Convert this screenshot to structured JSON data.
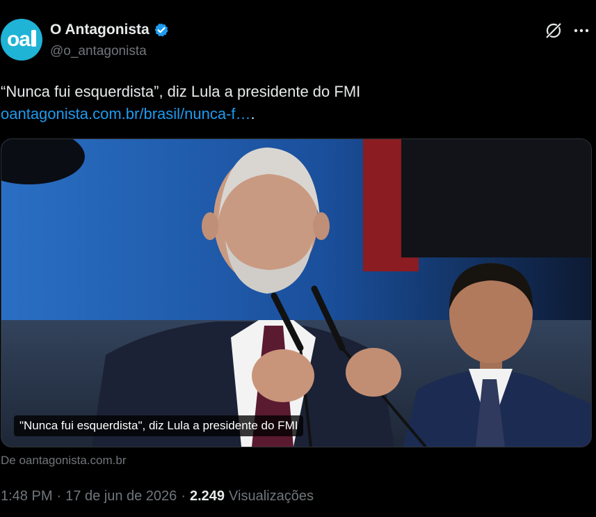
{
  "author": {
    "avatar_text": "oa",
    "display_name": "O Antagonista",
    "handle": "@o_antagonista"
  },
  "tweet": {
    "text": "“Nunca fui esquerdista”, diz Lula a presidente do FMI",
    "link": "oantagonista.com.br/brasil/nunca-f…",
    "link_tail": "."
  },
  "card": {
    "caption": "\"Nunca fui esquerdista\", diz Lula a presidente do FMI",
    "source": "De oantagonista.com.br"
  },
  "meta": {
    "time": "1:48 PM",
    "separator": "·",
    "date": "17 de jun de 2026",
    "views_count": "2.249",
    "views_label": "Visualizações"
  },
  "icons": {
    "verified": "verified-badge-icon",
    "grok": "grok-icon",
    "more": "more-horizontal-icon"
  },
  "colors": {
    "background": "#000000",
    "text": "#e7e9ea",
    "secondary": "#71767b",
    "link": "#1d9bf0",
    "avatar": "#1fb3d6"
  }
}
